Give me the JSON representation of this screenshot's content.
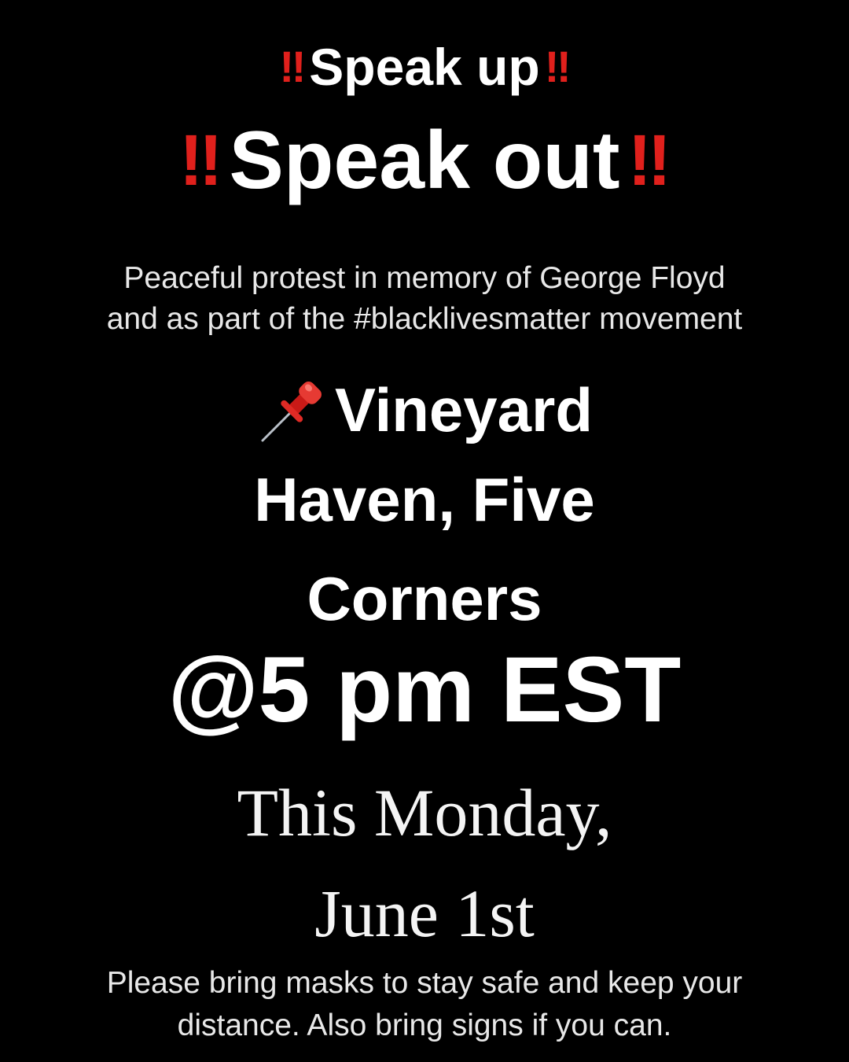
{
  "flyer": {
    "exclaim": "‼",
    "headline_1": "Speak up",
    "headline_2": "Speak out",
    "description_line_1": "Peaceful protest in memory of George Floyd",
    "description_line_2": "and as part of the #blacklivesmatter movement",
    "location_icon": "pushpin-icon",
    "location_line_1": "Vineyard",
    "location_line_2": "Haven, Five",
    "location_line_3": "Corners",
    "time": "@5 pm EST",
    "date_line_1": "This Monday,",
    "date_line_2": "June 1st",
    "footer_line_1": "Please bring masks to stay safe and keep your",
    "footer_line_2": "distance. Also bring signs if you can."
  },
  "colors": {
    "background": "#000000",
    "text": "#ffffff",
    "accent_red": "#e0201c"
  }
}
